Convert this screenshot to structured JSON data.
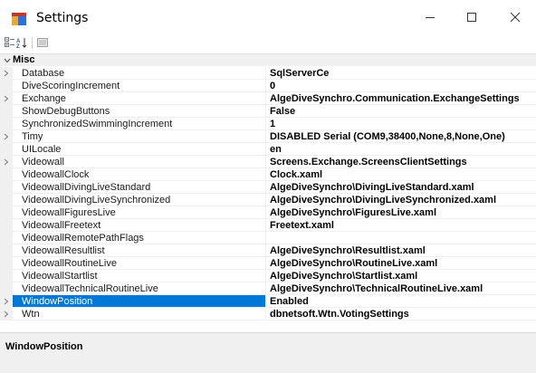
{
  "window": {
    "title": "Settings",
    "controls": [
      "minimize",
      "maximize",
      "close"
    ]
  },
  "toolbar": {
    "buttons": [
      "categorized-icon",
      "alphabetical-icon",
      "property-pages-icon"
    ]
  },
  "grid": {
    "category": {
      "label": "Misc",
      "expanded": true
    },
    "rows": [
      {
        "name": "Database",
        "value": "SqlServerCe",
        "expandable": true
      },
      {
        "name": "DiveScoringIncrement",
        "value": "0",
        "expandable": false
      },
      {
        "name": "Exchange",
        "value": "AlgeDiveSynchro.Communication.ExchangeSettings",
        "expandable": true
      },
      {
        "name": "ShowDebugButtons",
        "value": "False",
        "expandable": false
      },
      {
        "name": "SynchronizedSwimmingIncrement",
        "value": "1",
        "expandable": false
      },
      {
        "name": "Timy",
        "value": "DISABLED Serial (COM9,38400,None,8,None,One)",
        "expandable": true
      },
      {
        "name": "UILocale",
        "value": "en",
        "expandable": false
      },
      {
        "name": "Videowall",
        "value": "Screens.Exchange.ScreensClientSettings",
        "expandable": true
      },
      {
        "name": "VideowallClock",
        "value": "Clock.xaml",
        "expandable": false
      },
      {
        "name": "VideowallDivingLiveStandard",
        "value": "AlgeDiveSynchro\\DivingLiveStandard.xaml",
        "expandable": false
      },
      {
        "name": "VideowallDivingLiveSynchronized",
        "value": "AlgeDiveSynchro\\DivingLiveSynchronized.xaml",
        "expandable": false
      },
      {
        "name": "VideowallFiguresLive",
        "value": "AlgeDiveSynchro\\FiguresLive.xaml",
        "expandable": false
      },
      {
        "name": "VideowallFreetext",
        "value": "Freetext.xaml",
        "expandable": false
      },
      {
        "name": "VideowallRemotePathFlags",
        "value": "",
        "expandable": false
      },
      {
        "name": "VideowallResultlist",
        "value": "AlgeDiveSynchro\\Resultlist.xaml",
        "expandable": false
      },
      {
        "name": "VideowallRoutineLive",
        "value": "AlgeDiveSynchro\\RoutineLive.xaml",
        "expandable": false
      },
      {
        "name": "VideowallStartlist",
        "value": "AlgeDiveSynchro\\Startlist.xaml",
        "expandable": false
      },
      {
        "name": "VideowallTechnicalRoutineLive",
        "value": "AlgeDiveSynchro\\TechnicalRoutineLive.xaml",
        "expandable": false
      },
      {
        "name": "WindowPosition",
        "value": "Enabled",
        "expandable": true,
        "selected": true
      },
      {
        "name": "Wtn",
        "value": "dbnetsoft.Wtn.VotingSettings",
        "expandable": true
      }
    ]
  },
  "description": {
    "title": "WindowPosition"
  },
  "colors": {
    "selection": "#0078d7",
    "gutter": "#f0f0f0",
    "grid_line": "#f0f0f0"
  }
}
